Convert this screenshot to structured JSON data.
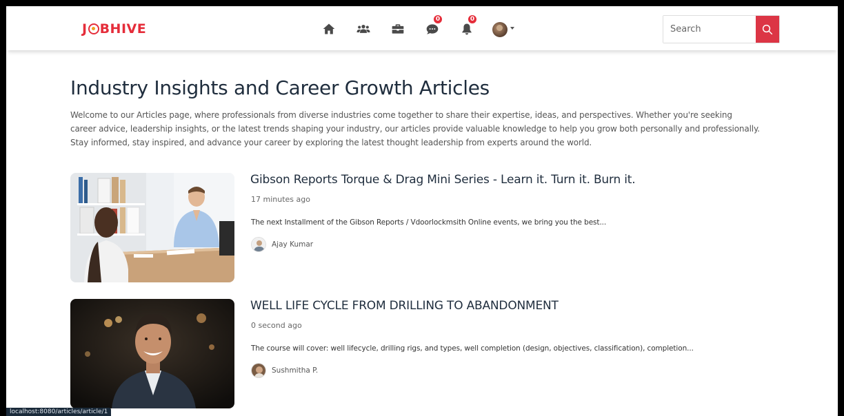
{
  "navbar": {
    "logo_prefix": "J",
    "logo_suffix": "BHIVE",
    "icons": [
      "home-icon",
      "network-icon",
      "jobs-icon",
      "messages-icon",
      "notifications-icon"
    ],
    "messages_badge": "0",
    "notifications_badge": "0",
    "search_placeholder": "Search"
  },
  "page": {
    "title": "Industry Insights and Career Growth Articles",
    "intro": "Welcome to our Articles page, where professionals from diverse industries come together to share their expertise, ideas, and perspectives. Whether you're seeking career advice, leadership insights, or the latest trends shaping your industry, our articles provide valuable knowledge to help you grow both personally and professionally. Stay informed, stay inspired, and advance your career by exploring the latest thought leadership from experts around the world."
  },
  "articles": [
    {
      "title": "Gibson Reports Torque & Drag Mini Series - Learn it. Turn it. Burn it.",
      "time": "17 minutes ago",
      "description": "The next Installment of the Gibson Reports / Vdoorlockmsith Online events, we bring you the best...",
      "author": "Ajay Kumar"
    },
    {
      "title": "WELL LIFE CYCLE FROM DRILLING TO ABANDONMENT",
      "time": "0 second ago",
      "description": "The course will cover: well lifecycle, drilling rigs, and types, well completion (design, objectives, classification), completion...",
      "author": "Sushmitha P."
    }
  ],
  "status_bar": {
    "url": "localhost:8080/articles/article/1"
  },
  "colors": {
    "brand": "#e52d3a",
    "search_button": "#dc3545",
    "title": "#1f2d3d"
  }
}
